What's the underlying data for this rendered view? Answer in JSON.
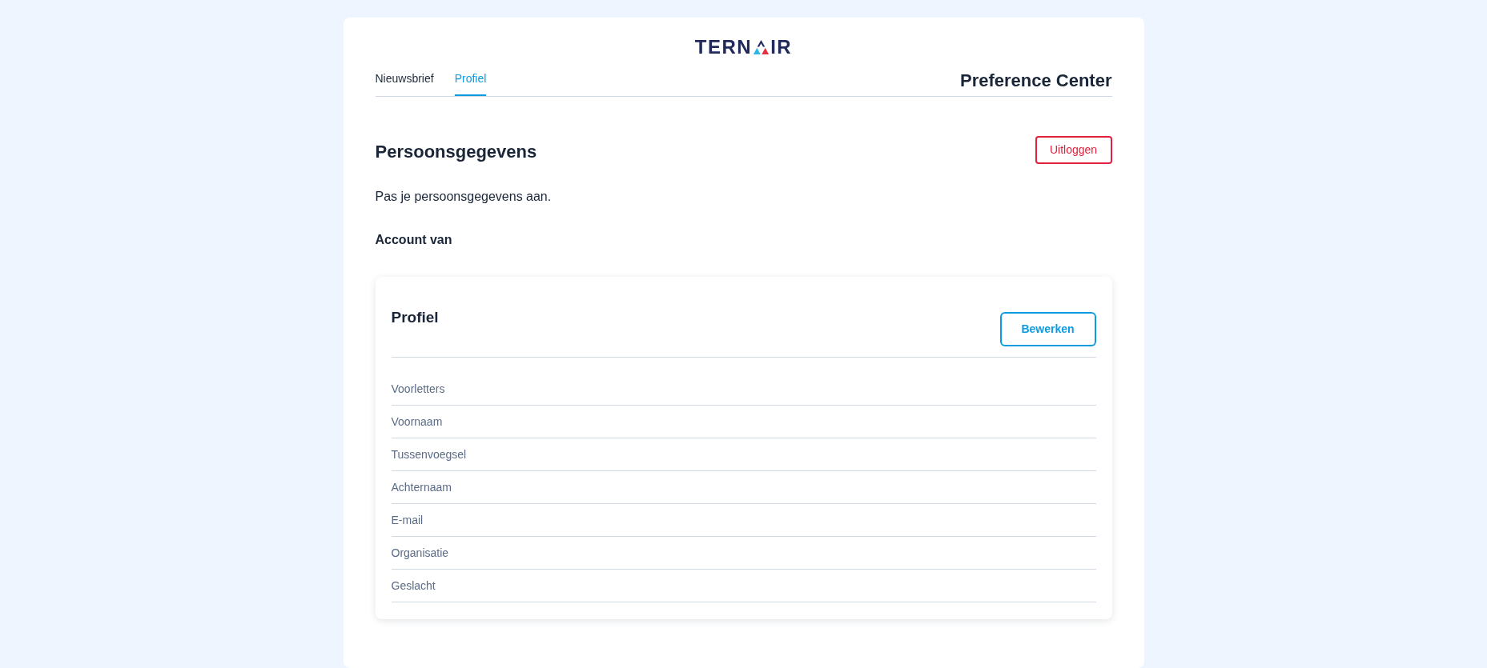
{
  "header": {
    "logo": {
      "text_before": "TERN",
      "text_after": "IR"
    },
    "tabs": [
      {
        "label": "Nieuwsbrief",
        "selected": false
      },
      {
        "label": "Profiel",
        "selected": true
      }
    ],
    "title": "Preference Center"
  },
  "section": {
    "title": "Persoonsgegevens",
    "logout_button": "Uitloggen",
    "description": "Pas je persoonsgegevens aan.",
    "account_label": "Account van"
  },
  "profile_card": {
    "title": "Profiel",
    "edit_button": "Bewerken",
    "fields": [
      "Voorletters",
      "Voornaam",
      "Tussenvoegsel",
      "Achternaam",
      "E-mail",
      "Organisatie",
      "Geslacht"
    ]
  }
}
